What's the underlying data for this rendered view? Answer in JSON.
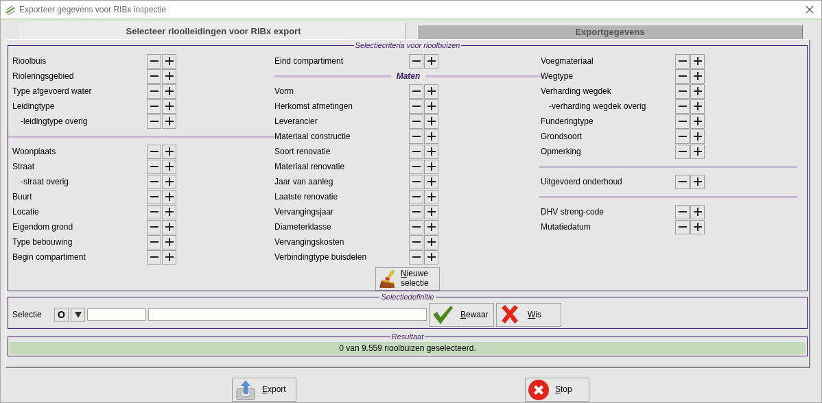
{
  "window": {
    "title": "Exporteer gegevens voor RIBx inspectie"
  },
  "tabs": [
    {
      "label": "Selecteer rioolleidingen voor RIBx export",
      "selected": true
    },
    {
      "label": "Exportgegevens",
      "selected": false
    }
  ],
  "criteria": {
    "legend": "Selectiecriteria voor rioolbuizen",
    "columns": [
      [
        {
          "kind": "criterion",
          "label": "Rioolbuis"
        },
        {
          "kind": "criterion",
          "label": "Rioleringsgebied"
        },
        {
          "kind": "criterion",
          "label": "Type afgevoerd water"
        },
        {
          "kind": "criterion",
          "label": "Leidingtype",
          "children": [
            {
              "kind": "criterion",
              "label": "-leidingtype overig"
            }
          ]
        },
        {
          "kind": "separator"
        },
        {
          "kind": "criterion",
          "label": "Woonplaats"
        },
        {
          "kind": "criterion",
          "label": "Straat",
          "children": [
            {
              "kind": "criterion",
              "label": "-straat overig"
            }
          ]
        },
        {
          "kind": "criterion",
          "label": "Buurt"
        },
        {
          "kind": "criterion",
          "label": "Locatie"
        },
        {
          "kind": "criterion",
          "label": "Eigendom grond"
        },
        {
          "kind": "criterion",
          "label": "Type bebouwing"
        },
        {
          "kind": "criterion",
          "label": "Begin compartiment"
        }
      ],
      [
        {
          "kind": "criterion",
          "label": "Eind compartiment"
        },
        {
          "kind": "heading",
          "label": "Maten"
        },
        {
          "kind": "criterion",
          "label": "Vorm"
        },
        {
          "kind": "criterion",
          "label": "Herkomst afmetingen"
        },
        {
          "kind": "criterion",
          "label": "Leverancier"
        },
        {
          "kind": "criterion",
          "label": "Materiaal constructie"
        },
        {
          "kind": "criterion",
          "label": "Soort renovatie"
        },
        {
          "kind": "criterion",
          "label": "Materiaal renovatie"
        },
        {
          "kind": "criterion",
          "label": "Jaar van aanleg"
        },
        {
          "kind": "criterion",
          "label": "Laatste renovatie"
        },
        {
          "kind": "criterion",
          "label": "Vervangingsjaar"
        },
        {
          "kind": "criterion",
          "label": "Diameterklasse"
        },
        {
          "kind": "criterion",
          "label": "Vervangingskosten"
        },
        {
          "kind": "criterion",
          "label": "Verbindingtype buisdelen"
        }
      ],
      [
        {
          "kind": "criterion",
          "label": "Voegmateriaal"
        },
        {
          "kind": "criterion",
          "label": "Wegtype"
        },
        {
          "kind": "criterion",
          "label": "Verharding wegdek",
          "children": [
            {
              "kind": "criterion",
              "label": "-verharding wegdek overig"
            }
          ]
        },
        {
          "kind": "criterion",
          "label": "Funderingtype"
        },
        {
          "kind": "criterion",
          "label": "Grondsoort"
        },
        {
          "kind": "criterion",
          "label": "Opmerking"
        },
        {
          "kind": "separator"
        },
        {
          "kind": "criterion",
          "label": "Uitgevoerd onderhoud"
        },
        {
          "kind": "separator"
        },
        {
          "kind": "criterion",
          "label": "DHV streng-code"
        },
        {
          "kind": "criterion",
          "label": "Mutatiedatum"
        }
      ]
    ],
    "new_selection_button": "Nieuwe selectie"
  },
  "selection_definition": {
    "legend": "Selectiedefinitie",
    "label": "Selectie",
    "mode_button": "O",
    "buttons": [
      {
        "label": "Bewaar",
        "kind": "save"
      },
      {
        "label": "Wis",
        "kind": "clear"
      }
    ]
  },
  "result": {
    "legend": "Resultaat",
    "message": "0 van 9.559 rioolbuizen geselecteerd."
  },
  "footer_buttons": [
    {
      "label": "Export",
      "kind": "export"
    },
    {
      "label": "Stop",
      "kind": "stop"
    }
  ]
}
